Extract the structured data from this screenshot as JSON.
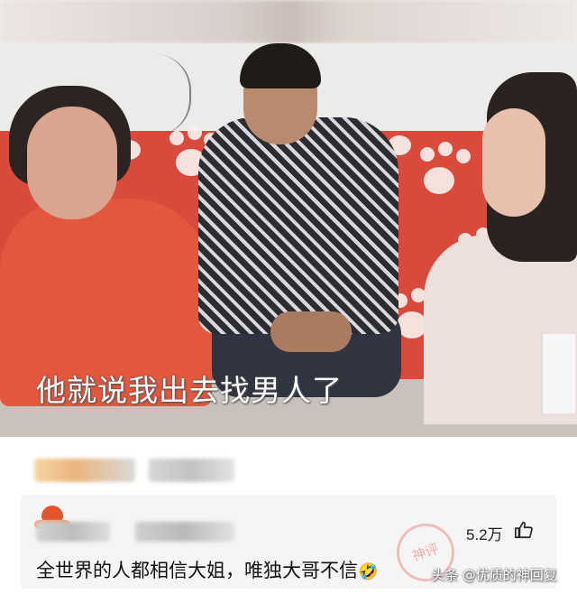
{
  "video": {
    "subtitle": "他就说我出去找男人了"
  },
  "comment": {
    "like_count": "5.2万",
    "like_icon": "thumbs-up-icon",
    "text": "全世界的人都相信大姐，唯独大哥不信",
    "emoji": "🤣"
  },
  "watermark": {
    "stamp_text": "神评",
    "text": "头条 @优质的神回复"
  },
  "colors": {
    "sofa": "#d94a3c",
    "card_bg": "#f5f5f5"
  }
}
